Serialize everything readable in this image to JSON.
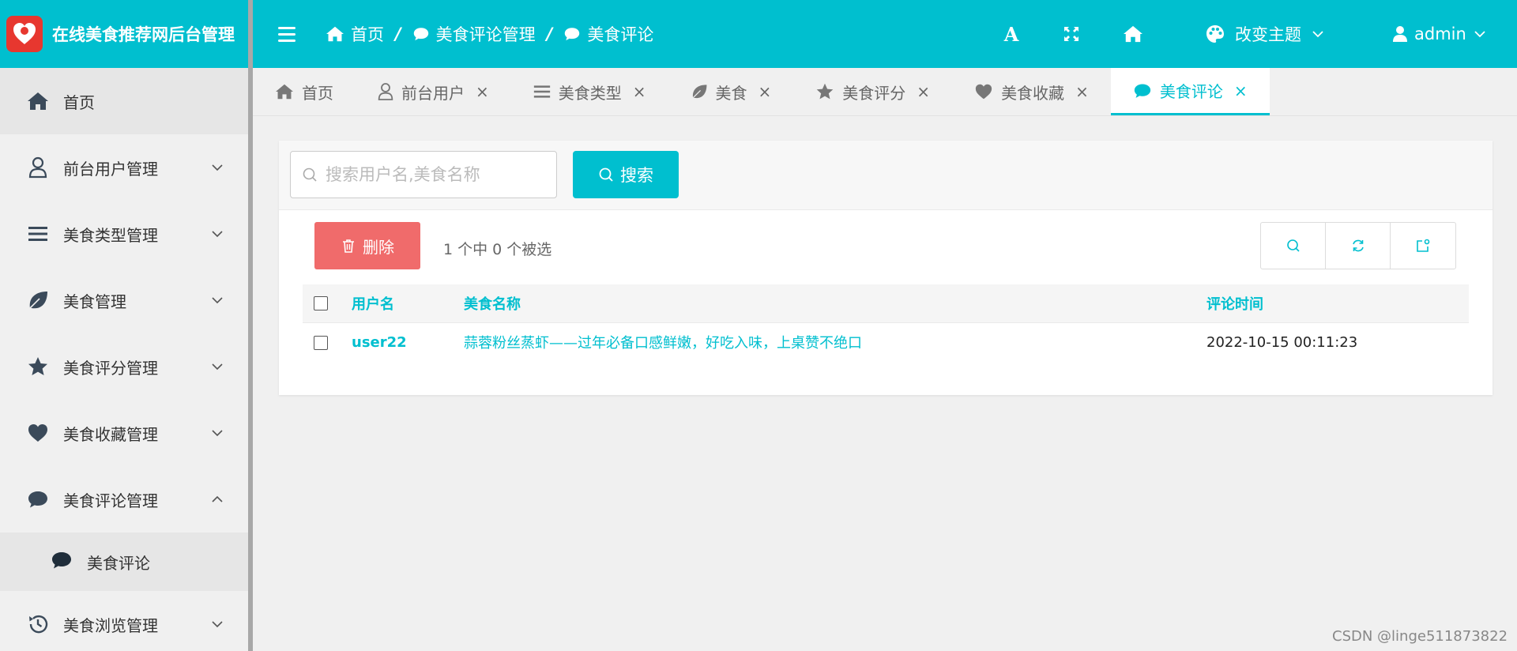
{
  "app": {
    "title": "在线美食推荐网后台管理"
  },
  "sidebar": {
    "items": [
      {
        "label": "首页",
        "icon": "home-icon"
      },
      {
        "label": "前台用户管理",
        "icon": "user-icon"
      },
      {
        "label": "美食类型管理",
        "icon": "list-icon"
      },
      {
        "label": "美食管理",
        "icon": "leaf-icon"
      },
      {
        "label": "美食评分管理",
        "icon": "star-icon"
      },
      {
        "label": "美食收藏管理",
        "icon": "heart-icon"
      },
      {
        "label": "美食评论管理",
        "icon": "comment-icon"
      },
      {
        "label": "美食浏览管理",
        "icon": "history-icon"
      }
    ],
    "submenu": {
      "label": "美食评论",
      "icon": "comment-icon"
    }
  },
  "header": {
    "breadcrumb": [
      "首页",
      "美食评论管理",
      "美食评论"
    ],
    "breadcrumb_sep": "/",
    "font_icon_label": "A",
    "theme_label": "改变主题",
    "user_label": "admin"
  },
  "tabs": [
    {
      "label": "首页",
      "icon": "home-icon",
      "closable": false
    },
    {
      "label": "前台用户",
      "icon": "user-icon",
      "closable": true
    },
    {
      "label": "美食类型",
      "icon": "list-icon",
      "closable": true
    },
    {
      "label": "美食",
      "icon": "leaf-icon",
      "closable": true
    },
    {
      "label": "美食评分",
      "icon": "star-icon",
      "closable": true
    },
    {
      "label": "美食收藏",
      "icon": "heart-icon",
      "closable": true
    },
    {
      "label": "美食评论",
      "icon": "comment-icon",
      "closable": true,
      "active": true
    }
  ],
  "tab_close": "×",
  "search": {
    "placeholder": "搜索用户名,美食名称",
    "button_label": "搜索"
  },
  "toolbar": {
    "delete_label": "删除",
    "selection_info": "1 个中 0 个被选"
  },
  "table": {
    "columns": [
      "用户名",
      "美食名称",
      "评论时间"
    ],
    "rows": [
      {
        "user": "user22",
        "food": "蒜蓉粉丝蒸虾——过年必备口感鲜嫩，好吃入味，上桌赞不绝口",
        "time": "2022-10-15 00:11:23"
      }
    ]
  },
  "watermark": "CSDN @linge511873822",
  "colors": {
    "primary": "#00bfcf",
    "danger": "#f06b6b",
    "sidebar_bg": "#f0f0f0"
  }
}
